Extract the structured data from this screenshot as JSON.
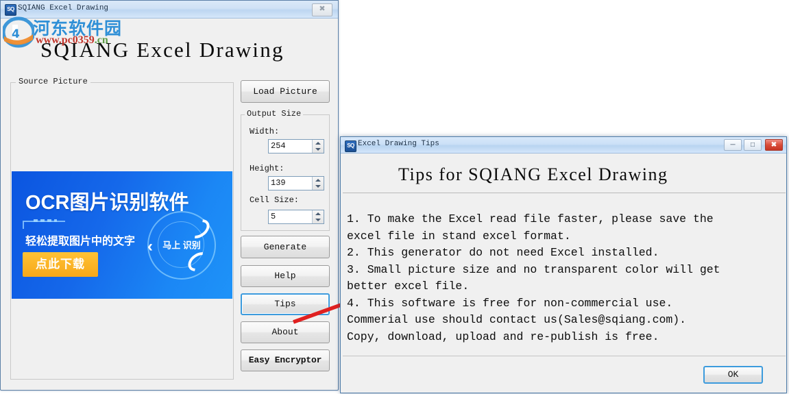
{
  "main_window": {
    "title": "SQIANG Excel Drawing",
    "icon": "sq-app-icon",
    "close_label": "✖",
    "heading": "SQIANG Excel Drawing",
    "source_group_label": "Source Picture",
    "output_group_label": "Output Size",
    "fields": [
      {
        "label": "Width:",
        "value": "254"
      },
      {
        "label": "Height:",
        "value": "139"
      },
      {
        "label": "Cell Size:",
        "value": "5"
      }
    ],
    "buttons": {
      "load_picture": "Load Picture",
      "generate": "Generate",
      "help": "Help",
      "tips": "Tips",
      "about": "About",
      "easy_encryptor": "Easy Encryptor"
    }
  },
  "source_picture": {
    "headline": "OCR图片识别软件",
    "subline": "轻松提取图片中的文字",
    "download_button": "点此下载",
    "badge_text": "马上\n识别",
    "chevron": "‹"
  },
  "watermark": {
    "site_name": "河东软件园",
    "url_prefix": "www.",
    "url_main": "pc0359",
    "url_suffix": ".cn"
  },
  "tips_dialog": {
    "title": "Excel Drawing Tips",
    "icon": "sq-app-icon",
    "minimize_label": "─",
    "maximize_label": "□",
    "close_label": "✖",
    "heading": "Tips for SQIANG Excel Drawing",
    "body": "1. To make the Excel read file faster, please save the\nexcel file in stand excel format.\n2. This generator do not need Excel installed.\n3. Small picture size and no transparent color will get\nbetter excel file.\n4. This software is free for non-commercial use.\nCommerial use should contact us(Sales@sqiang.com).\nCopy, download, upload and re-publish is free.",
    "ok_button": "OK"
  },
  "colors": {
    "accent_blue": "#3c9bdd",
    "banner_blue": "#0b55e0",
    "download_orange": "#f7a81a",
    "close_red": "#c63523",
    "annotation_red": "#e02020",
    "watermark_blue": "#2f8fd6",
    "watermark_green": "#5f9c49"
  }
}
